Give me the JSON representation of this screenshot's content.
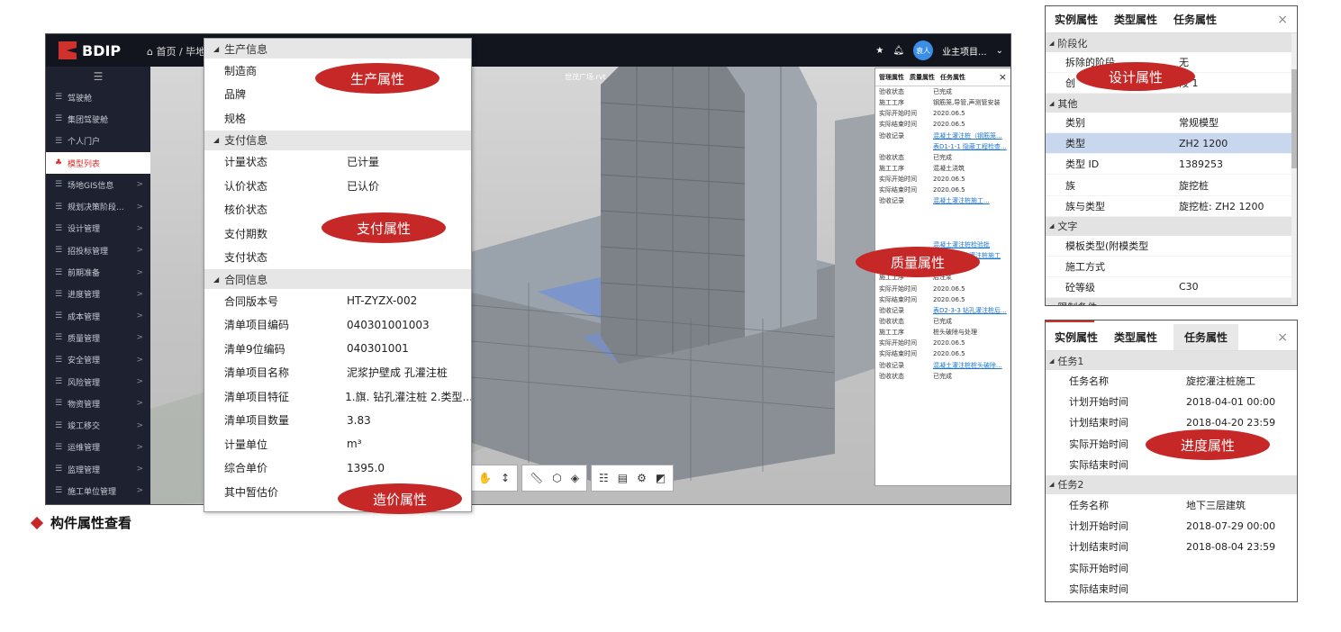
{
  "app": {
    "logo": "BDIP",
    "breadcrumb": "⌂ 首页  /  毕地",
    "user_avatar": "袁人",
    "user_project": "业主项目...",
    "viewport_title": "世茂广场.rvt",
    "sidebar_items": [
      {
        "label": "驾驶舱",
        "arrow": ""
      },
      {
        "label": "集团驾驶舱",
        "arrow": ""
      },
      {
        "label": "个人门户",
        "arrow": ""
      },
      {
        "label": "模型列表",
        "arrow": "",
        "active": true
      },
      {
        "label": "场地GIS信息",
        "arrow": ">"
      },
      {
        "label": "规划决策阶段...",
        "arrow": ">"
      },
      {
        "label": "设计管理",
        "arrow": ">"
      },
      {
        "label": "招投标管理",
        "arrow": ">"
      },
      {
        "label": "前期准备",
        "arrow": ">"
      },
      {
        "label": "进度管理",
        "arrow": ">"
      },
      {
        "label": "成本管理",
        "arrow": ">"
      },
      {
        "label": "质量管理",
        "arrow": ">"
      },
      {
        "label": "安全管理",
        "arrow": ">"
      },
      {
        "label": "风险管理",
        "arrow": ">"
      },
      {
        "label": "物资管理",
        "arrow": ">"
      },
      {
        "label": "竣工移交",
        "arrow": ">"
      },
      {
        "label": "运维管理",
        "arrow": ">"
      },
      {
        "label": "监理管理",
        "arrow": ">"
      },
      {
        "label": "施工单位管理",
        "arrow": ">"
      }
    ]
  },
  "mgmt_panel": {
    "tabs": [
      "管理属性",
      "质量属性",
      "任务属性"
    ],
    "rows": [
      {
        "k": "验收状态",
        "v": "已完成"
      },
      {
        "k": "施工工序",
        "v": "钢筋笼,导管,声测管安装"
      },
      {
        "k": "实际开始时间",
        "v": "2020.06.5"
      },
      {
        "k": "实际结束时间",
        "v": "2020.06.5"
      },
      {
        "k": "验收记录",
        "v": "混凝土灌注桩（钢筋笼...",
        "link": true
      },
      {
        "k": "",
        "v": "表D1-1-1 隐蔽工程检查...",
        "link": true
      },
      {
        "k": "验收状态",
        "v": "已完成"
      },
      {
        "k": "施工工序",
        "v": "混凝土浇筑"
      },
      {
        "k": "实际开始时间",
        "v": "2020.06.5"
      },
      {
        "k": "实际结束时间",
        "v": "2020.06.5"
      },
      {
        "k": "验收记录",
        "v": "混凝土灌注桩施工...",
        "link": true
      },
      {
        "k": "",
        "v": "",
        "link": false
      },
      {
        "k": "",
        "v": "",
        "link": false
      },
      {
        "k": "",
        "v": "",
        "link": false
      },
      {
        "k": "",
        "v": "混凝土灌注桩检验批",
        "link": true
      },
      {
        "k": "",
        "v": "D2-3-2 钻孔灌注桩施工",
        "link": true
      },
      {
        "k": "验收状态",
        "v": "已完成"
      },
      {
        "k": "施工工序",
        "v": "后注浆"
      },
      {
        "k": "实际开始时间",
        "v": "2020.06.5"
      },
      {
        "k": "实际结束时间",
        "v": "2020.06.5"
      },
      {
        "k": "验收记录",
        "v": "表D2-3-3 钻孔灌注桩后...",
        "link": true
      },
      {
        "k": "验收状态",
        "v": "已完成"
      },
      {
        "k": "施工工序",
        "v": "桩头破除与处理"
      },
      {
        "k": "实际开始时间",
        "v": "2020.06.5"
      },
      {
        "k": "实际结束时间",
        "v": "2020.06.5"
      },
      {
        "k": "验收记录",
        "v": "混凝土灌注桩桩头破除...",
        "link": true
      },
      {
        "k": "验收状态",
        "v": "已完成"
      }
    ]
  },
  "popup": {
    "sections": [
      {
        "title": "生产信息",
        "rows": [
          {
            "k": "制造商",
            "v": ""
          },
          {
            "k": "品牌",
            "v": ""
          },
          {
            "k": "规格",
            "v": ""
          }
        ]
      },
      {
        "title": "支付信息",
        "rows": [
          {
            "k": "计量状态",
            "v": "已计量"
          },
          {
            "k": "认价状态",
            "v": "已认价"
          },
          {
            "k": "核价状态",
            "v": ""
          },
          {
            "k": "支付期数",
            "v": ""
          },
          {
            "k": "支付状态",
            "v": ""
          }
        ]
      },
      {
        "title": "合同信息",
        "rows": [
          {
            "k": "合同版本号",
            "v": "HT-ZYZX-002"
          },
          {
            "k": "清单项目编码",
            "v": "040301001003"
          },
          {
            "k": "清单9位编码",
            "v": "040301001"
          },
          {
            "k": "清单项目名称",
            "v": "泥浆护壁成 孔灌注桩"
          },
          {
            "k": "清单项目特征",
            "v": "1.旗. 钻孔灌注桩 2.类型..."
          },
          {
            "k": "清单项目数量",
            "v": "3.83"
          },
          {
            "k": "计量单位",
            "v": "m³"
          },
          {
            "k": "综合单价",
            "v": "1395.0"
          },
          {
            "k": "其中暂估价",
            "v": ""
          }
        ]
      }
    ]
  },
  "badges": {
    "production": "生产属性",
    "payment": "支付属性",
    "quality": "质量属性",
    "cost": "造价属性",
    "design": "设计属性",
    "progress": "进度属性"
  },
  "design_panel": {
    "tabs": [
      "实例属性",
      "类型属性",
      "任务属性"
    ],
    "close": "×",
    "sections": [
      {
        "title": "阶段化",
        "rows": [
          {
            "k": "拆除的阶段",
            "v": "无"
          },
          {
            "k": "创",
            "v": "段 1"
          }
        ]
      },
      {
        "title": "其他",
        "rows": [
          {
            "k": "类别",
            "v": "常规模型"
          },
          {
            "k": "类型",
            "v": "ZH2 1200",
            "hl": true
          },
          {
            "k": "类型 ID",
            "v": "1389253"
          },
          {
            "k": "族",
            "v": "旋挖桩"
          },
          {
            "k": "族与类型",
            "v": "旋挖桩: ZH2 1200"
          }
        ]
      },
      {
        "title": "文字",
        "rows": [
          {
            "k": "模板类型(附模类型",
            "v": ""
          },
          {
            "k": "施工方式",
            "v": ""
          },
          {
            "k": "砼等级",
            "v": "C30"
          }
        ]
      },
      {
        "title": "限制条件",
        "rows": []
      }
    ]
  },
  "task_panel": {
    "tabs": [
      "实例属性",
      "类型属性",
      "任务属性"
    ],
    "close": "×",
    "sections": [
      {
        "title": "任务1",
        "rows": [
          {
            "k": "任务名称",
            "v": "旋挖灌注桩施工"
          },
          {
            "k": "计划开始时间",
            "v": "2018-04-01 00:00"
          },
          {
            "k": "计划结束时间",
            "v": "2018-04-20 23:59"
          },
          {
            "k": "实际开始时间",
            "v": ""
          },
          {
            "k": "实际结束时间",
            "v": ""
          }
        ]
      },
      {
        "title": "任务2",
        "rows": [
          {
            "k": "任务名称",
            "v": "地下三层建筑"
          },
          {
            "k": "计划开始时间",
            "v": "2018-07-29 00:00"
          },
          {
            "k": "计划结束时间",
            "v": "2018-08-04 23:59"
          },
          {
            "k": "实际开始时间",
            "v": ""
          },
          {
            "k": "实际结束时间",
            "v": ""
          }
        ]
      }
    ]
  },
  "caption": "构件属性查看",
  "colors": {
    "accent_red": "#c62828",
    "nav_bg": "#1e2230",
    "highlight": "#c8d7ee"
  }
}
